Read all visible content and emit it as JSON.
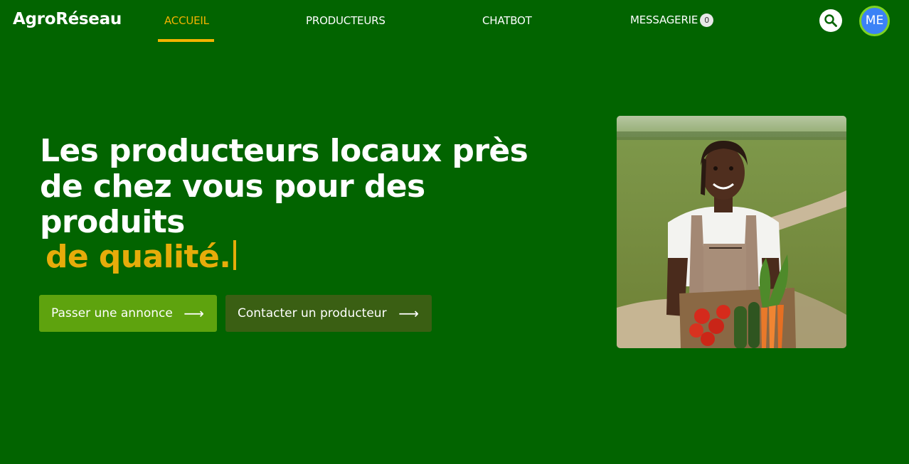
{
  "brand": {
    "name": "AgroRéseau"
  },
  "nav": {
    "items": [
      {
        "label": "ACCUEIL",
        "active": true
      },
      {
        "label": "PRODUCTEURS",
        "active": false
      },
      {
        "label": "CHATBOT",
        "active": false
      },
      {
        "label": "MESSAGERIE",
        "active": false,
        "badge": "0"
      }
    ],
    "search_icon": "search-icon",
    "avatar_initials": "ME",
    "accent_color": "#f2b300"
  },
  "hero": {
    "title": "Les producteurs locaux près de chez vous pour des produits",
    "title_accent": "de qualité.",
    "buttons": [
      {
        "label": "Passer une annonce",
        "icon": "arrow-right-icon"
      },
      {
        "label": "Contacter un producteur",
        "icon": "arrow-right-icon"
      }
    ],
    "image_alt": "farmer-with-vegetable-crate"
  },
  "colors": {
    "background": "#026400",
    "accent_yellow": "#e6ac0a",
    "primary_button": "#5ea30e",
    "secondary_button": "#3a5f13"
  }
}
